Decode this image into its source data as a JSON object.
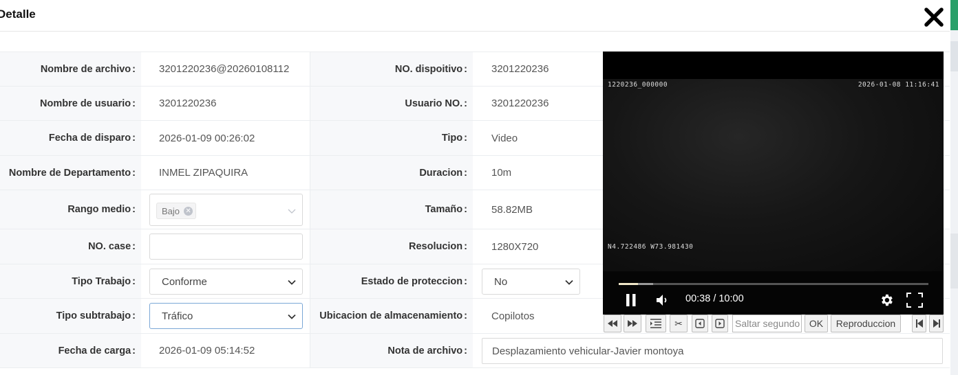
{
  "dialog": {
    "title": "Detalle"
  },
  "rows": [
    {
      "label1": "Nombre de archivo",
      "value1": "3201220236@20260108112",
      "label2": "NO. dispoitivo",
      "value2": "3201220236"
    },
    {
      "label1": "Nombre de usuario",
      "value1": "3201220236",
      "label2": "Usuario NO.",
      "value2": "3201220236"
    },
    {
      "label1": "Fecha de disparo",
      "value1": "2026-01-09 00:26:02",
      "label2": "Tipo",
      "value2": "Video"
    },
    {
      "label1": "Nombre de Departamento",
      "value1": "INMEL ZIPAQUIRA",
      "label2": "Duracion",
      "value2": "10m"
    },
    {
      "label1": "Rango medio",
      "tag": "Bajo",
      "label2": "Tamaño",
      "value2": "58.82MB"
    },
    {
      "label1": "NO. case",
      "case_value": "",
      "label2": "Resolucion",
      "value2": "1280X720"
    },
    {
      "label1": "Tipo Trabajo",
      "select1": "Conforme",
      "label2": "Estado de proteccion",
      "select2": "No"
    },
    {
      "label1": "Tipo subtrabajo",
      "select1": "Tráfico",
      "label2": "Ubicacion de almacenamiento",
      "value2": "Copilotos"
    },
    {
      "label1": "Fecha de carga",
      "value1": "2026-01-09 05:14:52",
      "label2": "Nota de archivo",
      "note": "Desplazamiento vehicular-Javier montoya"
    }
  ],
  "colon": ":",
  "video": {
    "overlay_top_left": "1220236_000000",
    "overlay_top_right": "2026-01-08 11:16:41",
    "overlay_gps": "N4.722486 W73.981430",
    "time": "00:38 / 10:00",
    "progress_fraction": 0.0633
  },
  "toolbar": {
    "seek_placeholder": "Saltar segundo",
    "ok_label": "OK",
    "playback_label": "Reproduccion"
  },
  "icons": [
    "close-icon",
    "chevron-down-icon",
    "tag-close-icon",
    "pause-icon",
    "volume-icon",
    "settings-icon",
    "fullscreen-icon",
    "rewind-icon",
    "fast-forward-icon",
    "list-icon",
    "scissors-icon",
    "frame-back-icon",
    "frame-forward-icon",
    "skip-start-icon",
    "skip-end-icon"
  ]
}
